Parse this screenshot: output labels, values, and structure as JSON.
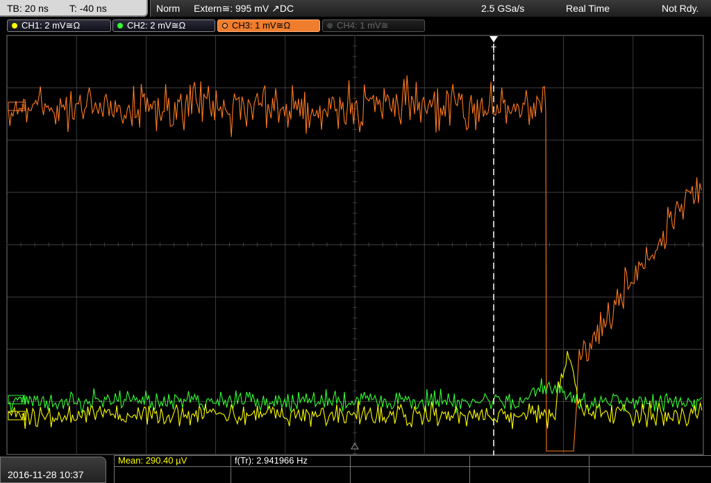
{
  "status_bar": {
    "timebase": "TB: 20 ns",
    "trigger_offset": "T: -40 ns",
    "trigger_mode": "Norm",
    "trigger_source": "Extern≅: 995 mV ↗DC",
    "sample_rate": "2.5 GSa/s",
    "acq_mode": "Real Time",
    "run_state": "Not Rdy."
  },
  "channels": [
    {
      "label": "CH1: 2 mV≅Ω",
      "color": "#ffff00",
      "active": true
    },
    {
      "label": "CH2: 2 mV≅Ω",
      "color": "#33ff33",
      "active": true
    },
    {
      "label": "CH3: 1 mV≅Ω",
      "color": "#ff7a22",
      "active": true
    },
    {
      "label": "CH4: 1 mV≅",
      "color": "#666666",
      "active": false
    }
  ],
  "markers": {
    "ch3": "3",
    "ch2": "2",
    "ch1": "1",
    "trigger_top": "T"
  },
  "colors": {
    "ch1": "#ffff00",
    "ch2": "#33ff33",
    "ch3": "#ff7a22",
    "grid": "#555555"
  },
  "bottom_bar": {
    "datetime": "2016-11-28 10:37",
    "measurements": [
      {
        "label": "Mean: 290.40 µV",
        "color": "#ffff00"
      },
      {
        "label": "f(Tr): 2.941966 Hz",
        "color": "#ffffff"
      }
    ]
  }
}
